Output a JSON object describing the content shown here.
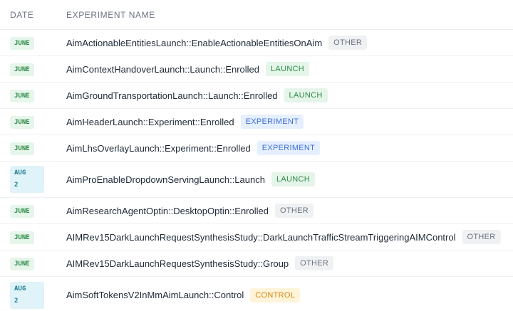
{
  "columns": {
    "date": "DATE",
    "name": "EXPERIMENT NAME"
  },
  "rows": [
    {
      "date_line1": "JUNE",
      "date_line2": "",
      "date_type": "june",
      "name": "AimActionableEntitiesLaunch::EnableActionableEntitiesOnAim",
      "tag": "OTHER",
      "tag_type": "other"
    },
    {
      "date_line1": "JUNE",
      "date_line2": "",
      "date_type": "june",
      "name": "AimContextHandoverLaunch::Launch::Enrolled",
      "tag": "LAUNCH",
      "tag_type": "launch"
    },
    {
      "date_line1": "JUNE",
      "date_line2": "",
      "date_type": "june",
      "name": "AimGroundTransportationLaunch::Launch::Enrolled",
      "tag": "LAUNCH",
      "tag_type": "launch"
    },
    {
      "date_line1": "JUNE",
      "date_line2": "",
      "date_type": "june",
      "name": "AimHeaderLaunch::Experiment::Enrolled",
      "tag": "EXPERIMENT",
      "tag_type": "experiment"
    },
    {
      "date_line1": "JUNE",
      "date_line2": "",
      "date_type": "june",
      "name": "AimLhsOverlayLaunch::Experiment::Enrolled",
      "tag": "EXPERIMENT",
      "tag_type": "experiment"
    },
    {
      "date_line1": "AUG",
      "date_line2": "2",
      "date_type": "aug",
      "name": "AimProEnableDropdownServingLaunch::Launch",
      "tag": "LAUNCH",
      "tag_type": "launch"
    },
    {
      "date_line1": "JUNE",
      "date_line2": "",
      "date_type": "june",
      "name": "AimResearchAgentOptin::DesktopOptin::Enrolled",
      "tag": "OTHER",
      "tag_type": "other"
    },
    {
      "date_line1": "JUNE",
      "date_line2": "",
      "date_type": "june",
      "name": "AIMRev15DarkLaunchRequestSynthesisStudy::DarkLaunchTrafficStreamTriggeringAIMControl",
      "tag": "OTHER",
      "tag_type": "other"
    },
    {
      "date_line1": "JUNE",
      "date_line2": "",
      "date_type": "june",
      "name": "AIMRev15DarkLaunchRequestSynthesisStudy::Group",
      "tag": "OTHER",
      "tag_type": "other"
    },
    {
      "date_line1": "AUG",
      "date_line2": "2",
      "date_type": "aug",
      "name": "AimSoftTokensV2InMmAimLaunch::Control",
      "tag": "CONTROL",
      "tag_type": "control"
    }
  ]
}
